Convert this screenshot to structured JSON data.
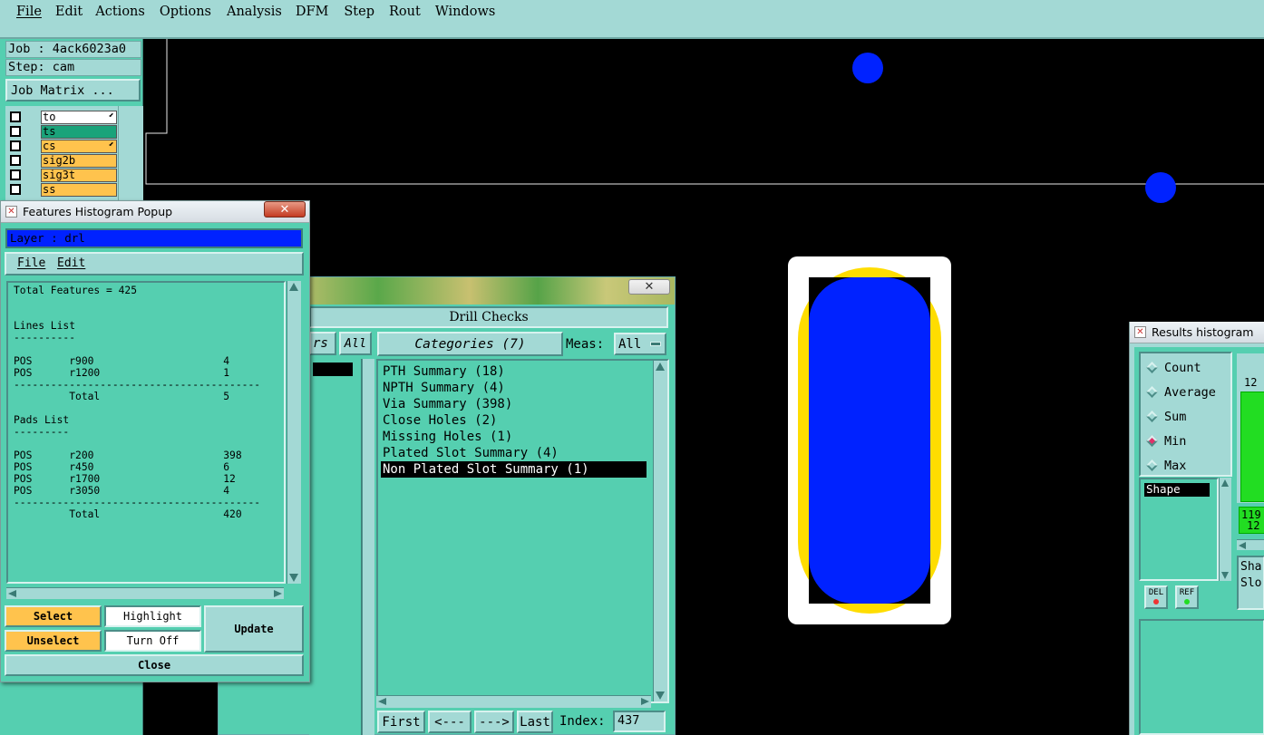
{
  "menubar": {
    "items": [
      {
        "key": "file",
        "label": "File"
      },
      {
        "key": "edit",
        "label": "Edit"
      },
      {
        "key": "actions",
        "label": "Actions"
      },
      {
        "key": "options",
        "label": "Options"
      },
      {
        "key": "analysis",
        "label": "Analysis"
      },
      {
        "key": "dfm",
        "label": "DFM"
      },
      {
        "key": "step",
        "label": "Step"
      },
      {
        "key": "rout",
        "label": "Rout"
      },
      {
        "key": "windows",
        "label": "Windows"
      }
    ]
  },
  "left_panel": {
    "job": "Job : 4ack6023a0",
    "step": "Step: cam",
    "job_matrix_label": "Job Matrix ...",
    "layers": [
      {
        "name": "to",
        "color": "#ffffff",
        "mark": "⬋"
      },
      {
        "name": "ts",
        "color": "#1aa37a",
        "mark": ""
      },
      {
        "name": "cs",
        "color": "#ffc34d",
        "mark": "⬋"
      },
      {
        "name": "sig2b",
        "color": "#ffc34d",
        "mark": ""
      },
      {
        "name": "sig3t",
        "color": "#ffc34d",
        "mark": ""
      },
      {
        "name": "ss",
        "color": "#ffc34d",
        "mark": ""
      }
    ]
  },
  "features_popup": {
    "title": "Features Histogram Popup",
    "layer_label": "Layer :  drl",
    "menu": {
      "file": "File",
      "edit": "Edit"
    },
    "report_lines": [
      "Total Features = 425",
      "",
      "",
      "Lines List",
      "----------",
      "",
      "POS      r900                     4",
      "POS      r1200                    1",
      "----------------------------------------",
      "         Total                    5",
      "",
      "Pads List",
      "---------",
      "",
      "POS      r200                     398",
      "POS      r450                     6",
      "POS      r1700                    12",
      "POS      r3050                    4",
      "----------------------------------------",
      "         Total                    420"
    ],
    "buttons": {
      "select": "Select",
      "highlight": "Highlight",
      "update": "Update",
      "unselect": "Unselect",
      "turn_off": "Turn Off",
      "close": "Close"
    }
  },
  "drill_checks": {
    "title": "Drill Checks",
    "left_header_partial": "rs",
    "all_label": "All",
    "categories_label": "Categories (7)",
    "meas_label": "Meas:",
    "meas_value": "All",
    "categories": [
      {
        "label": "PTH Summary (18)",
        "selected": false
      },
      {
        "label": "NPTH Summary (4)",
        "selected": false
      },
      {
        "label": "Via Summary (398)",
        "selected": false
      },
      {
        "label": "Close Holes (2)",
        "selected": false
      },
      {
        "label": "Missing Holes (1)",
        "selected": false
      },
      {
        "label": "Plated Slot Summary (4)",
        "selected": false
      },
      {
        "label": "Non Plated Slot Summary (1)",
        "selected": true
      }
    ],
    "nav": {
      "first": "First",
      "prev": "<---",
      "next": "--->",
      "last": "Last",
      "index_label": "Index:",
      "index_value": "437"
    }
  },
  "results_histogram": {
    "title": "Results histogram",
    "options": [
      {
        "label": "Count",
        "selected": false
      },
      {
        "label": "Average",
        "selected": false
      },
      {
        "label": "Sum",
        "selected": false
      },
      {
        "label": "Min",
        "selected": true
      },
      {
        "label": "Max",
        "selected": false
      }
    ],
    "list_item": "Shape",
    "del_label": "DEL",
    "ref_label": "REF",
    "partial_value_top": "12",
    "partial_value_box1": "119",
    "partial_value_box2": "12",
    "partial_text_1": "Sha",
    "partial_text_2": "Slo"
  },
  "colors": {
    "panel": "#55cfb0",
    "panel_light": "#a3d9d5",
    "layer_blue": "#0022ff",
    "pad_yellow": "#ffdd00",
    "accent_orange": "#ffc34d"
  }
}
